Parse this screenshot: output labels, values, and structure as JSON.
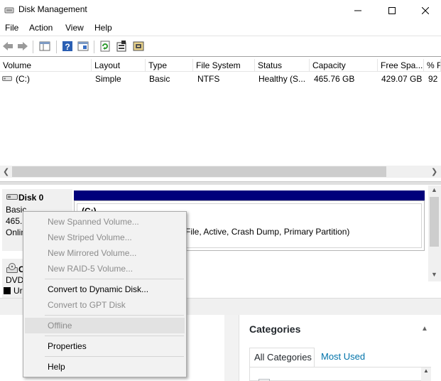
{
  "window": {
    "title": "Disk Management"
  },
  "menubar": {
    "items": [
      "File",
      "Action",
      "View",
      "Help"
    ]
  },
  "toolbar": {
    "icons": [
      "back-icon",
      "forward-icon",
      "show-hide-console-tree-icon",
      "help-icon",
      "help-topics-icon",
      "refresh-icon",
      "properties-icon",
      "rescan-disks-icon"
    ]
  },
  "volume_list": {
    "columns": [
      "Volume",
      "Layout",
      "Type",
      "File System",
      "Status",
      "Capacity",
      "Free Spa...",
      "% F"
    ],
    "rows": [
      {
        "volume": "(C:)",
        "layout": "Simple",
        "type": "Basic",
        "file_system": "NTFS",
        "status": "Healthy (S...",
        "capacity": "465.76 GB",
        "free_space": "429.07 GB",
        "pct_free": "92"
      }
    ]
  },
  "disks": {
    "disk0": {
      "name": "Disk 0",
      "type": "Basic",
      "size": "465.7",
      "status": "Onlin",
      "partition": {
        "name": "(C:)",
        "description": "File, Active, Crash Dump, Primary Partition)"
      }
    },
    "cdrom0": {
      "name": "C",
      "type": "DVD",
      "status": "Ur"
    }
  },
  "context_menu": {
    "items": [
      {
        "label": "New Spanned Volume...",
        "enabled": false
      },
      {
        "label": "New Striped Volume...",
        "enabled": false
      },
      {
        "label": "New Mirrored Volume...",
        "enabled": false
      },
      {
        "label": "New RAID-5 Volume...",
        "enabled": false
      },
      {
        "label": "Convert to Dynamic Disk...",
        "enabled": true
      },
      {
        "label": "Convert to GPT Disk",
        "enabled": false
      },
      {
        "label": "Offline",
        "enabled": false
      },
      {
        "label": "Properties",
        "enabled": true
      },
      {
        "label": "Help",
        "enabled": true
      }
    ]
  },
  "categories_panel": {
    "title": "Categories",
    "tabs": [
      "All Categories",
      "Most Used"
    ]
  },
  "colors": {
    "disk_bar": "#00007b",
    "link": "#0073aa",
    "disabled_text": "#8c8c8c"
  }
}
